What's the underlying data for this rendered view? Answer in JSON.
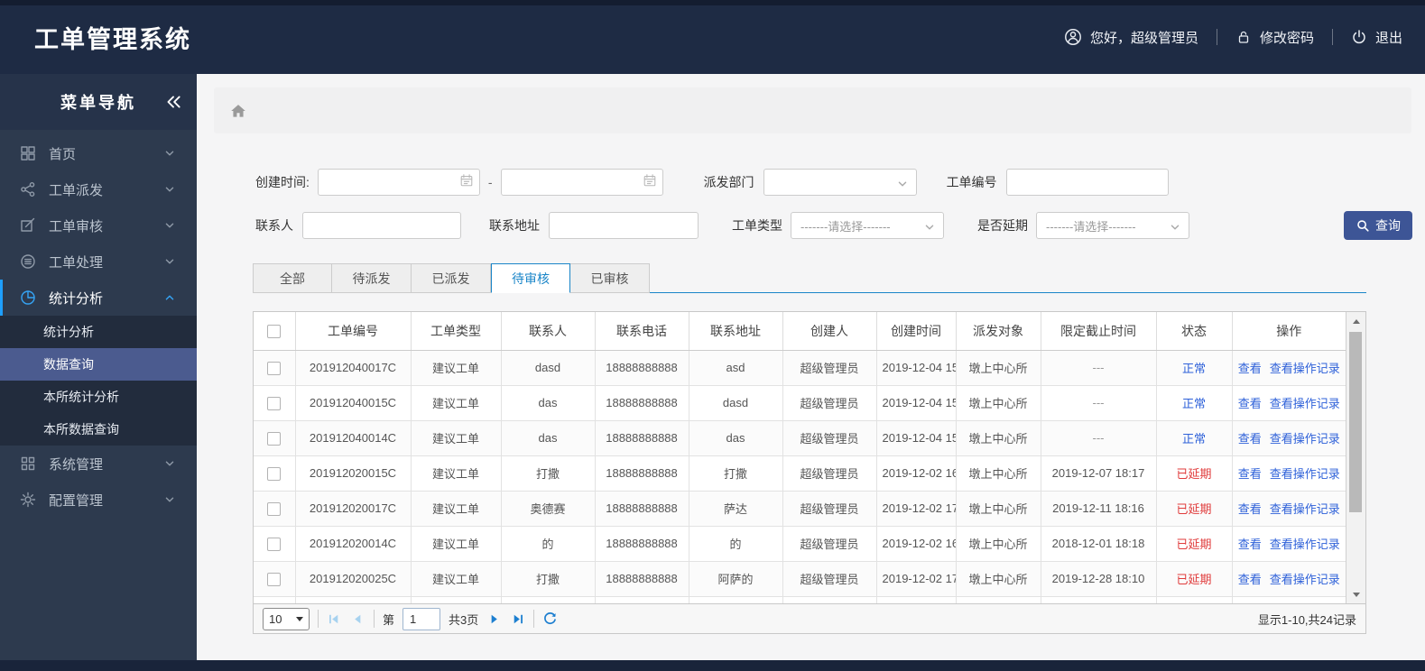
{
  "header": {
    "title": "工单管理系统",
    "greeting": "您好，超级管理员",
    "change_password": "修改密码",
    "logout": "退出"
  },
  "sidebar": {
    "title": "菜单导航",
    "items": [
      {
        "key": "home",
        "label": "首页",
        "icon": "grid-icon",
        "expanded": false
      },
      {
        "key": "order-dispatch",
        "label": "工单派发",
        "icon": "share-icon",
        "expanded": false
      },
      {
        "key": "order-review",
        "label": "工单审核",
        "icon": "edit-icon",
        "expanded": false
      },
      {
        "key": "order-process",
        "label": "工单处理",
        "icon": "stack-icon",
        "expanded": false
      },
      {
        "key": "stats-analysis",
        "label": "统计分析",
        "icon": "pie-chart-icon",
        "expanded": true,
        "active": true,
        "children": [
          {
            "key": "stats-analysis-sub",
            "label": "统计分析",
            "selected": false
          },
          {
            "key": "data-query",
            "label": "数据查询",
            "selected": true
          },
          {
            "key": "branch-stats-analysis",
            "label": "本所统计分析",
            "selected": false
          },
          {
            "key": "branch-data-query",
            "label": "本所数据查询",
            "selected": false
          }
        ]
      },
      {
        "key": "system-mgmt",
        "label": "系统管理",
        "icon": "modules-icon",
        "expanded": false
      },
      {
        "key": "config-mgmt",
        "label": "配置管理",
        "icon": "gear-icon",
        "expanded": false
      }
    ]
  },
  "filters": {
    "create_time_label": "创建时间:",
    "date_separator": "-",
    "dispatch_dept_label": "派发部门",
    "order_no_label": "工单编号",
    "contact_label": "联系人",
    "address_label": "联系地址",
    "order_type_label": "工单类型",
    "order_type_placeholder": "-------请选择-------",
    "delay_label": "是否延期",
    "delay_placeholder": "-------请选择-------",
    "search_button": "查询"
  },
  "tabs": [
    {
      "key": "all",
      "label": "全部",
      "active": false
    },
    {
      "key": "pending-dispatch",
      "label": "待派发",
      "active": false
    },
    {
      "key": "dispatched",
      "label": "已派发",
      "active": false
    },
    {
      "key": "pending-review",
      "label": "待审核",
      "active": true
    },
    {
      "key": "reviewed",
      "label": "已审核",
      "active": false
    }
  ],
  "table": {
    "columns": [
      "工单编号",
      "工单类型",
      "联系人",
      "联系电话",
      "联系地址",
      "创建人",
      "创建时间",
      "派发对象",
      "限定截止时间",
      "状态",
      "操作"
    ],
    "view_label": "查看",
    "view_log_label": "查看操作记录",
    "rows": [
      {
        "order_no": "201912040017C",
        "type": "建议工单",
        "contact": "dasd",
        "phone": "18888888888",
        "address": "asd",
        "creator": "超级管理员",
        "created": "2019-12-04 15",
        "target": "墩上中心所",
        "deadline": "---",
        "status": "正常",
        "delayed": false
      },
      {
        "order_no": "201912040015C",
        "type": "建议工单",
        "contact": "das",
        "phone": "18888888888",
        "address": "dasd",
        "creator": "超级管理员",
        "created": "2019-12-04 15",
        "target": "墩上中心所",
        "deadline": "---",
        "status": "正常",
        "delayed": false
      },
      {
        "order_no": "201912040014C",
        "type": "建议工单",
        "contact": "das",
        "phone": "18888888888",
        "address": "das",
        "creator": "超级管理员",
        "created": "2019-12-04 15",
        "target": "墩上中心所",
        "deadline": "---",
        "status": "正常",
        "delayed": false
      },
      {
        "order_no": "201912020015C",
        "type": "建议工单",
        "contact": "打撒",
        "phone": "18888888888",
        "address": "打撒",
        "creator": "超级管理员",
        "created": "2019-12-02 16",
        "target": "墩上中心所",
        "deadline": "2019-12-07 18:17",
        "status": "已延期",
        "delayed": true
      },
      {
        "order_no": "201912020017C",
        "type": "建议工单",
        "contact": "奥德赛",
        "phone": "18888888888",
        "address": "萨达",
        "creator": "超级管理员",
        "created": "2019-12-02 17",
        "target": "墩上中心所",
        "deadline": "2019-12-11 18:16",
        "status": "已延期",
        "delayed": true
      },
      {
        "order_no": "201912020014C",
        "type": "建议工单",
        "contact": "的",
        "phone": "18888888888",
        "address": "的",
        "creator": "超级管理员",
        "created": "2019-12-02 16",
        "target": "墩上中心所",
        "deadline": "2018-12-01 18:18",
        "status": "已延期",
        "delayed": true
      },
      {
        "order_no": "201912020025C",
        "type": "建议工单",
        "contact": "打撒",
        "phone": "18888888888",
        "address": "阿萨的",
        "creator": "超级管理员",
        "created": "2019-12-02 17",
        "target": "墩上中心所",
        "deadline": "2019-12-28 18:10",
        "status": "已延期",
        "delayed": true
      }
    ]
  },
  "pagination": {
    "page_size": "10",
    "page_prefix": "第",
    "current_page": "1",
    "total_pages": "共3页",
    "summary": "显示1-10,共24记录"
  },
  "colors": {
    "status_normal": "#2e61d9",
    "status_delayed": "#e03b3b",
    "link": "#2e61d9",
    "accent_blue": "#1a85c8",
    "pager_icon": "#1d7fd0",
    "pager_icon_disabled": "#a7d2ef",
    "search_button_bg": "#3d5596"
  }
}
